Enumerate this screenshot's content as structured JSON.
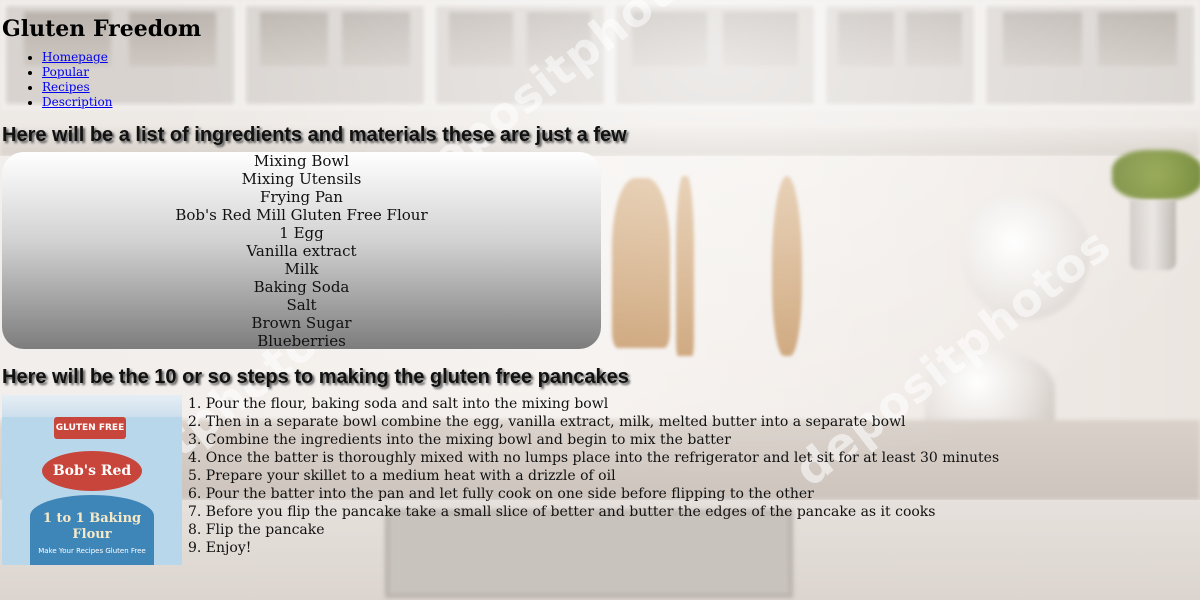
{
  "site": {
    "title": "Gluten Freedom"
  },
  "nav": {
    "items": [
      {
        "label": "Homepage"
      },
      {
        "label": "Popular"
      },
      {
        "label": "Recipes"
      },
      {
        "label": "Description"
      }
    ]
  },
  "ingredients_section": {
    "heading": "Here will be a list of ingredients and materials these are just a few",
    "items": [
      "Mixing Bowl",
      "Mixing Utensils",
      "Frying Pan",
      "Bob's Red Mill Gluten Free Flour",
      "1 Egg",
      "Vanilla extract",
      "Milk",
      "Baking Soda",
      "Salt",
      "Brown Sugar",
      "Blueberries"
    ]
  },
  "steps_section": {
    "heading": "Here will be the 10 or so steps to making the gluten free pancakes",
    "steps": [
      "1. Pour the flour, baking soda and salt into the mixing bowl",
      "2. Then in a separate bowl combine the egg, vanilla extract, milk, melted butter into a separate bowl",
      "3. Combine the ingredients into the mixing bowl and begin to mix the batter",
      "4. Once the batter is thoroughly mixed with no lumps place into the refrigerator and let sit for at least 30 minutes",
      "5. Prepare your skillet to a medium heat with a drizzle of oil",
      "6. Pour the batter into the pan and let fully cook on one side before flipping to the other",
      "7. Before you flip the pancake take a small slice of better and butter the edges of the pancake as it cooks",
      "8. Flip the pancake",
      "9. Enjoy!"
    ]
  },
  "product_image": {
    "badge": "GLUTEN FREE",
    "brand": "Bob's Red Mill",
    "product": "1 to 1 Baking Flour",
    "tagline": "Make Your Recipes Gluten Free"
  },
  "background": {
    "watermark": "depositphotos"
  }
}
